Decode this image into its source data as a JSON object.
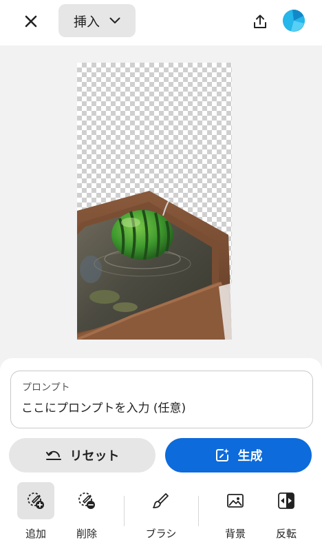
{
  "header": {
    "mode_label": "挿入"
  },
  "prompt": {
    "label": "プロンプト",
    "placeholder": "ここにプロンプトを入力 (任意)"
  },
  "actions": {
    "reset_label": "リセット",
    "generate_label": "生成"
  },
  "toolbar": {
    "items": [
      {
        "label": "追加",
        "icon": "brush-add-icon",
        "active": true
      },
      {
        "label": "削除",
        "icon": "brush-remove-icon",
        "active": false
      },
      {
        "label": "ブラシ",
        "icon": "brush-icon",
        "active": false
      },
      {
        "label": "背景",
        "icon": "image-icon",
        "active": false
      },
      {
        "label": "反転",
        "icon": "invert-icon",
        "active": false
      }
    ]
  },
  "colors": {
    "accent": "#0d6bdb",
    "avatar": "#25b6ea"
  }
}
